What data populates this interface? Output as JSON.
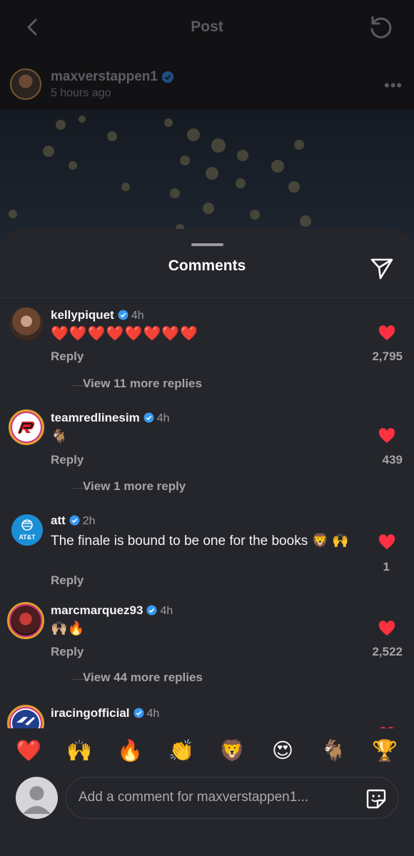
{
  "colors": {
    "sheet_bg": "#25262b",
    "like_red": "#ff3040",
    "verified_blue": "#3897f0",
    "muted_text": "#a3a3a8"
  },
  "header": {
    "title": "Post",
    "back_icon": "chevron-left-icon",
    "refresh_icon": "refresh-icon"
  },
  "post": {
    "username": "maxverstappen1",
    "time": "5 hours ago",
    "more_icon": "more-horizontal-icon"
  },
  "sheet": {
    "title": "Comments",
    "share_icon": "send-icon"
  },
  "comments": [
    {
      "username": "kellypiquet",
      "time": "4h",
      "text": "❤️❤️❤️❤️❤️❤️❤️❤️",
      "reply": "Reply",
      "likes": "2,795",
      "more": "View 11 more replies"
    },
    {
      "username": "teamredlinesim",
      "time": "4h",
      "text": "🐐",
      "reply": "Reply",
      "likes": "439",
      "more": "View 1 more reply"
    },
    {
      "username": "att",
      "time": "2h",
      "text": "The finale is bound to be one for the books 🦁 🙌",
      "reply": "Reply",
      "likes": "1",
      "more": ""
    },
    {
      "username": "marcmarquez93",
      "time": "4h",
      "text": "🙌🏼🔥",
      "reply": "Reply",
      "likes": "2,522",
      "more": "View 44 more replies"
    },
    {
      "username": "iracingofficial",
      "time": "4h",
      "text": "",
      "reply": "",
      "likes": "",
      "more": ""
    }
  ],
  "att_avatar_label": "AT&T",
  "emoji_bar": [
    "❤️",
    "🙌",
    "🔥",
    "👏",
    "🦁",
    "😍",
    "🐐",
    "🏆"
  ],
  "composer": {
    "placeholder": "Add a comment for maxverstappen1...",
    "sticker_icon": "sticker-icon"
  }
}
